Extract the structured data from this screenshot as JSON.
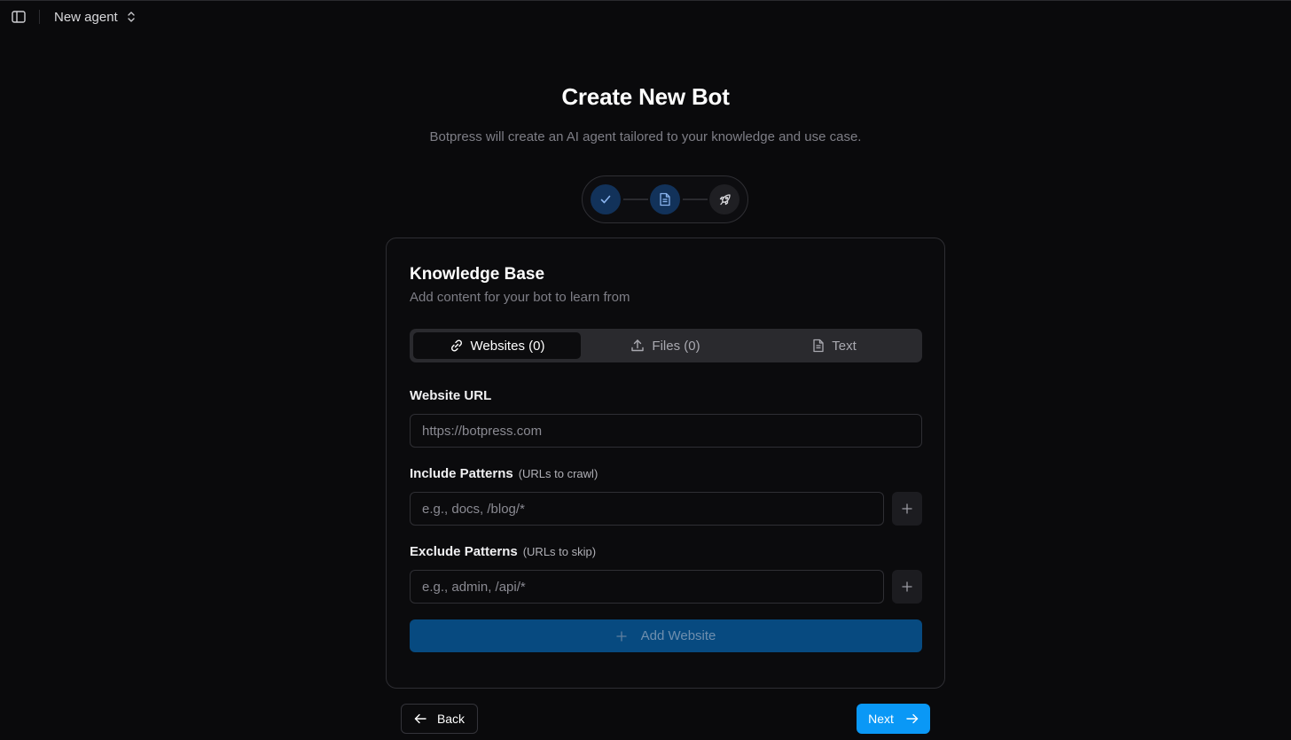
{
  "topbar": {
    "agent_name": "New agent",
    "icons": [
      "sidebar-toggle-icon",
      "chevron-up-down-icon"
    ]
  },
  "header": {
    "title": "Create New Bot",
    "subtitle": "Botpress will create an AI agent tailored to your knowledge and use case."
  },
  "stepper": {
    "steps": [
      {
        "icon": "check-icon",
        "state": "done"
      },
      {
        "icon": "document-icon",
        "state": "active"
      },
      {
        "icon": "rocket-icon",
        "state": "pending"
      }
    ]
  },
  "card": {
    "title": "Knowledge Base",
    "subtitle": "Add content for your bot to learn from",
    "tabs": [
      {
        "label": "Websites (0)",
        "icon": "link-icon",
        "active": true
      },
      {
        "label": "Files (0)",
        "icon": "upload-icon",
        "active": false
      },
      {
        "label": "Text",
        "icon": "document-icon",
        "active": false
      }
    ],
    "website_url": {
      "label": "Website URL",
      "placeholder": "https://botpress.com",
      "value": ""
    },
    "include": {
      "label": "Include Patterns",
      "hint": "(URLs to crawl)",
      "placeholder": "e.g., docs, /blog/*",
      "value": ""
    },
    "exclude": {
      "label": "Exclude Patterns",
      "hint": "(URLs to skip)",
      "placeholder": "e.g., admin, /api/*",
      "value": ""
    },
    "add_website_label": "Add Website"
  },
  "footer": {
    "back_label": "Back",
    "next_label": "Next"
  },
  "colors": {
    "accent": "#0a98f6",
    "add_button_disabled": "#074a80",
    "step_active_bg": "#12325a",
    "background": "#0a0a0c"
  }
}
